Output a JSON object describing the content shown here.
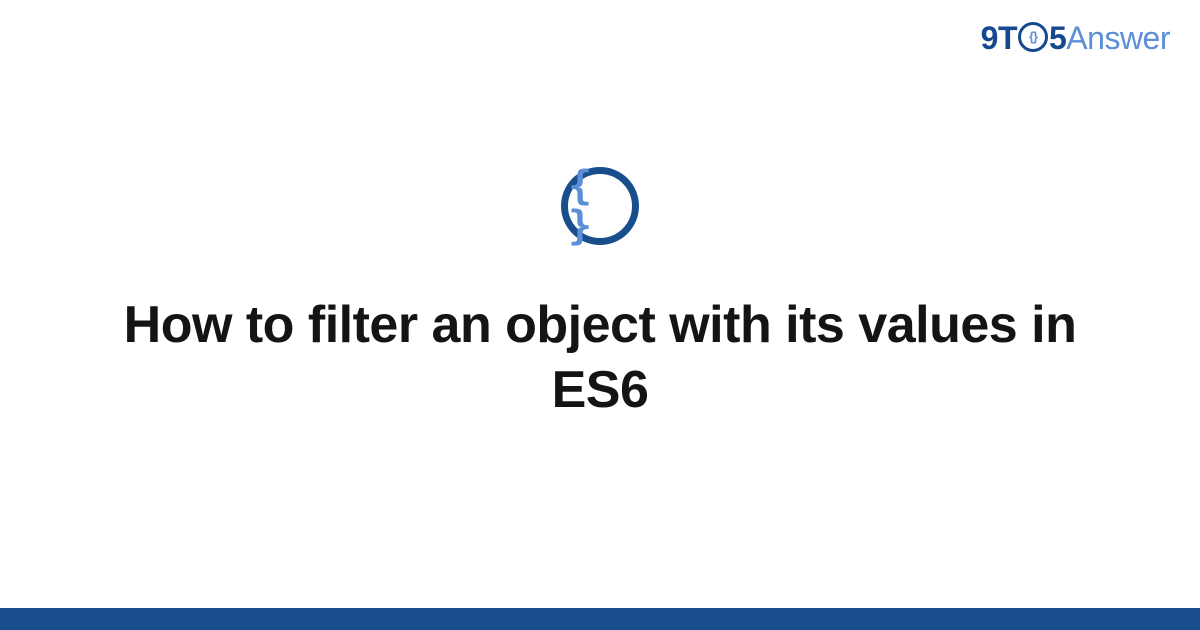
{
  "brand": {
    "part1": "9T",
    "innerBraces": "{}",
    "part2": "5",
    "part3": "Answer"
  },
  "icon": {
    "glyph": "{ }"
  },
  "title": "How to filter an object with its values in ES6",
  "colors": {
    "darkBlue": "#194e8c",
    "lightBlue": "#5b8fd6",
    "text": "#141414"
  }
}
